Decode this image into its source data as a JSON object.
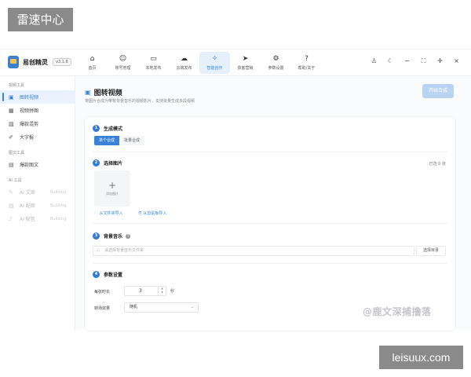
{
  "watermarks": {
    "top": "雷速中心",
    "bottom": "leisuux.com",
    "overlay": "@鹿文深捕撸落"
  },
  "app": {
    "name": "易创精灵",
    "version": "v3.1.8"
  },
  "nav": [
    {
      "label": "首页",
      "icon": "home-icon",
      "glyph": "⌂",
      "active": false
    },
    {
      "label": "账号管理",
      "icon": "user-icon",
      "glyph": "☺",
      "active": false
    },
    {
      "label": "本地发布",
      "icon": "monitor-icon",
      "glyph": "▭",
      "active": false
    },
    {
      "label": "云端发布",
      "icon": "cloud-icon",
      "glyph": "☁",
      "active": false
    },
    {
      "label": "智能创作",
      "icon": "magic-icon",
      "glyph": "✧",
      "active": true
    },
    {
      "label": "获客营销",
      "icon": "send-icon",
      "glyph": "➤",
      "active": false
    },
    {
      "label": "参数设置",
      "icon": "gear-icon",
      "glyph": "⚙",
      "active": false
    },
    {
      "label": "帮助/关于",
      "icon": "help-icon",
      "glyph": "?",
      "active": false
    }
  ],
  "window_controls": [
    {
      "name": "account-icon",
      "glyph": "♙"
    },
    {
      "name": "theme-moon-icon",
      "glyph": "☾"
    },
    {
      "name": "minimize-icon",
      "glyph": "−"
    },
    {
      "name": "maximize-icon",
      "glyph": "⛶"
    },
    {
      "name": "pin-icon",
      "glyph": "✛"
    },
    {
      "name": "close-icon",
      "glyph": "×"
    }
  ],
  "sidebar": {
    "sections": [
      {
        "title": "视频工具",
        "items": [
          {
            "label": "图转视频",
            "icon": "video-icon",
            "glyph": "▣",
            "active": true,
            "disabled": false,
            "badge": ""
          },
          {
            "label": "视频拼图",
            "icon": "grid-icon",
            "glyph": "▦",
            "active": false,
            "disabled": false,
            "badge": ""
          },
          {
            "label": "爆款混剪",
            "icon": "image-icon",
            "glyph": "▧",
            "active": false,
            "disabled": false,
            "badge": ""
          },
          {
            "label": "大字报",
            "icon": "brush-icon",
            "glyph": "✐",
            "active": false,
            "disabled": false,
            "badge": ""
          }
        ]
      },
      {
        "title": "图文工具",
        "items": [
          {
            "label": "爆款图文",
            "icon": "doc-icon",
            "glyph": "▤",
            "active": false,
            "disabled": false,
            "badge": ""
          }
        ]
      },
      {
        "title": "AI 工具",
        "items": [
          {
            "label": "AI 文案",
            "icon": "pen-icon",
            "glyph": "✎",
            "active": false,
            "disabled": true,
            "badge": "Building"
          },
          {
            "label": "AI 配图",
            "icon": "picture-icon",
            "glyph": "▨",
            "active": false,
            "disabled": true,
            "badge": "Building"
          },
          {
            "label": "AI 配音",
            "icon": "mic-icon",
            "glyph": "♪",
            "active": false,
            "disabled": true,
            "badge": "Building"
          }
        ]
      }
    ]
  },
  "main": {
    "title": "图转视频",
    "subtitle": "将图片合成为带有背景音乐的视频影片，支持批量生成多段视频",
    "generate_button": "开始合成",
    "sections": {
      "mode": {
        "num": "1",
        "title": "生成模式",
        "tabs": [
          "单个合成",
          "批量合成"
        ],
        "active_tab": 0
      },
      "images": {
        "num": "2",
        "title": "选择图片",
        "count": "已选 0 张",
        "add_label": "添加图片",
        "import_folder": "从文件夹导入",
        "import_clipboard": "从剪贴板导入"
      },
      "music": {
        "num": "3",
        "title": "背景音乐",
        "placeholder": "请选择背景音乐文件夹",
        "button": "选择目录"
      },
      "params": {
        "num": "4",
        "title": "参数设置",
        "duration_label": "每张时长",
        "duration_value": "3",
        "duration_unit": "秒",
        "transition_label": "转场效果",
        "transition_value": "随机"
      }
    }
  }
}
